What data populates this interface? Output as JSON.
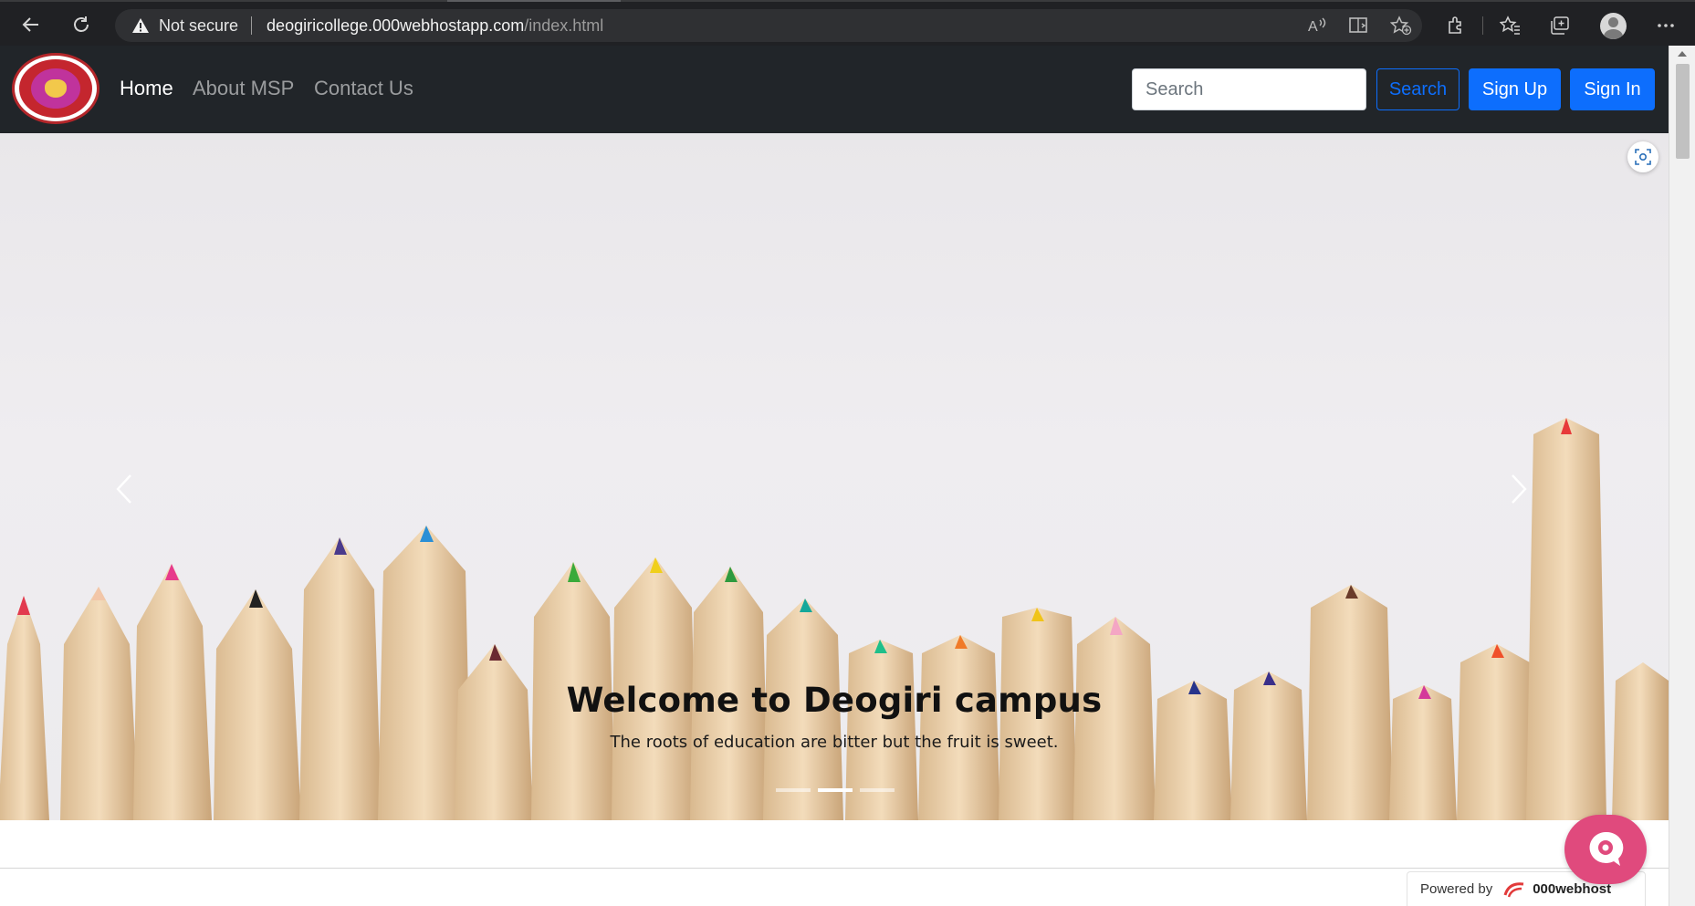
{
  "browser": {
    "security_label": "Not secure",
    "url_host": "deogiricollege.000webhostapp.com",
    "url_path": "/index.html"
  },
  "navbar": {
    "links": [
      {
        "label": "Home",
        "active": true
      },
      {
        "label": "About MSP",
        "active": false
      },
      {
        "label": "Contact Us",
        "active": false
      }
    ],
    "search_placeholder": "Search",
    "search_button": "Search",
    "signup_button": "Sign Up",
    "signin_button": "Sign In"
  },
  "carousel": {
    "title": "Welcome to Deogiri campus",
    "subtitle": "The roots of education are bitter but the fruit is sweet.",
    "slide_count": 3,
    "active_slide": 2
  },
  "footer": {
    "powered_by": "Powered by",
    "brand": "000webhost"
  },
  "colors": {
    "navbar_bg": "#212529",
    "primary": "#0d6efd",
    "chat_button": "#e04a7d"
  }
}
